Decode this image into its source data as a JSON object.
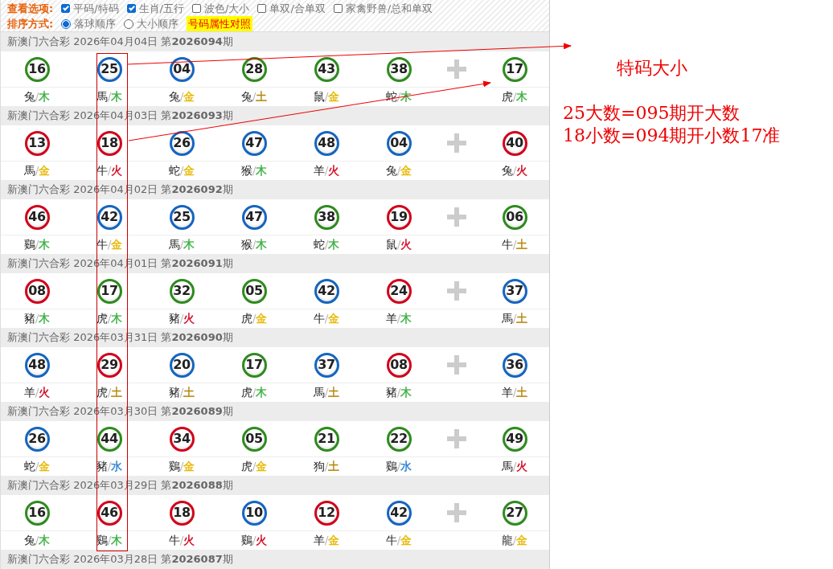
{
  "options": {
    "label": "查看选项:",
    "checkboxes": [
      {
        "label": "平码/特码",
        "checked": true
      },
      {
        "label": "生肖/五行",
        "checked": true
      },
      {
        "label": "波色/大小",
        "checked": false
      },
      {
        "label": "单双/合单双",
        "checked": false
      },
      {
        "label": "家禽野兽/总和单双",
        "checked": false
      }
    ]
  },
  "sort": {
    "label": "排序方式:",
    "radios": [
      {
        "label": "落球顺序",
        "selected": true
      },
      {
        "label": "大小顺序",
        "selected": false
      }
    ],
    "link": "号码属性对照"
  },
  "draws": [
    {
      "title": "新澳门六合彩 2026年04月04日 第**2026094**期",
      "balls": [
        {
          "number": "16",
          "color": "#2e8b1e",
          "label": "兔/木",
          "element": {
            "color": "#3cb043"
          }
        },
        {
          "number": "25",
          "color": "#1565c0",
          "label": "馬/木",
          "element": {
            "color": "#3cb043"
          }
        },
        {
          "number": "04",
          "color": "#1565c0",
          "label": "兔/金",
          "element": {
            "color": "#e6b800"
          }
        },
        {
          "number": "28",
          "color": "#2e8b1e",
          "label": "兔/土",
          "element": {
            "color": "#b8860b"
          }
        },
        {
          "number": "43",
          "color": "#2e8b1e",
          "label": "鼠/金",
          "element": {
            "color": "#e6b800"
          }
        },
        {
          "number": "38",
          "color": "#2e8b1e",
          "label": "蛇/木",
          "element": {
            "color": "#3cb043"
          }
        },
        {
          "number": "17",
          "color": "#2e8b1e",
          "label": "虎/木",
          "element": {
            "color": "#3cb043"
          }
        }
      ]
    },
    {
      "title": "新澳门六合彩 2026年04月03日 第**2026093**期",
      "balls": [
        {
          "number": "13",
          "color": "#d0021b",
          "label": "馬/金",
          "element": {
            "color": "#e6b800"
          }
        },
        {
          "number": "18",
          "color": "#d0021b",
          "label": "牛/火",
          "element": {
            "color": "#d0021b"
          }
        },
        {
          "number": "26",
          "color": "#1565c0",
          "label": "蛇/金",
          "element": {
            "color": "#e6b800"
          }
        },
        {
          "number": "47",
          "color": "#1565c0",
          "label": "猴/木",
          "element": {
            "color": "#3cb043"
          }
        },
        {
          "number": "48",
          "color": "#1565c0",
          "label": "羊/火",
          "element": {
            "color": "#d0021b"
          }
        },
        {
          "number": "04",
          "color": "#1565c0",
          "label": "兔/金",
          "element": {
            "color": "#e6b800"
          }
        },
        {
          "number": "40",
          "color": "#d0021b",
          "label": "兔/火",
          "element": {
            "color": "#d0021b"
          }
        }
      ]
    },
    {
      "title": "新澳门六合彩 2026年04月02日 第**2026092**期",
      "balls": [
        {
          "number": "46",
          "color": "#d0021b",
          "label": "鷄/木",
          "element": {
            "color": "#3cb043"
          }
        },
        {
          "number": "42",
          "color": "#1565c0",
          "label": "牛/金",
          "element": {
            "color": "#e6b800"
          }
        },
        {
          "number": "25",
          "color": "#1565c0",
          "label": "馬/木",
          "element": {
            "color": "#3cb043"
          }
        },
        {
          "number": "47",
          "color": "#1565c0",
          "label": "猴/木",
          "element": {
            "color": "#3cb043"
          }
        },
        {
          "number": "38",
          "color": "#2e8b1e",
          "label": "蛇/木",
          "element": {
            "color": "#3cb043"
          }
        },
        {
          "number": "19",
          "color": "#d0021b",
          "label": "鼠/火",
          "element": {
            "color": "#d0021b"
          }
        },
        {
          "number": "06",
          "color": "#2e8b1e",
          "label": "牛/土",
          "element": {
            "color": "#b8860b"
          }
        }
      ]
    },
    {
      "title": "新澳门六合彩 2026年04月01日 第**2026091**期",
      "balls": [
        {
          "number": "08",
          "color": "#d0021b",
          "label": "豬/木",
          "element": {
            "color": "#3cb043"
          }
        },
        {
          "number": "17",
          "color": "#2e8b1e",
          "label": "虎/木",
          "element": {
            "color": "#3cb043"
          }
        },
        {
          "number": "32",
          "color": "#2e8b1e",
          "label": "豬/火",
          "element": {
            "color": "#d0021b"
          }
        },
        {
          "number": "05",
          "color": "#2e8b1e",
          "label": "虎/金",
          "element": {
            "color": "#e6b800"
          }
        },
        {
          "number": "42",
          "color": "#1565c0",
          "label": "牛/金",
          "element": {
            "color": "#e6b800"
          }
        },
        {
          "number": "24",
          "color": "#d0021b",
          "label": "羊/木",
          "element": {
            "color": "#3cb043"
          }
        },
        {
          "number": "37",
          "color": "#1565c0",
          "label": "馬/土",
          "element": {
            "color": "#b8860b"
          }
        }
      ]
    },
    {
      "title": "新澳门六合彩 2026年03月31日 第**2026090**期",
      "balls": [
        {
          "number": "48",
          "color": "#1565c0",
          "label": "羊/火",
          "element": {
            "color": "#d0021b"
          }
        },
        {
          "number": "29",
          "color": "#d0021b",
          "label": "虎/土",
          "element": {
            "color": "#b8860b"
          }
        },
        {
          "number": "20",
          "color": "#1565c0",
          "label": "豬/土",
          "element": {
            "color": "#b8860b"
          }
        },
        {
          "number": "17",
          "color": "#2e8b1e",
          "label": "虎/木",
          "element": {
            "color": "#3cb043"
          }
        },
        {
          "number": "37",
          "color": "#1565c0",
          "label": "馬/土",
          "element": {
            "color": "#b8860b"
          }
        },
        {
          "number": "08",
          "color": "#d0021b",
          "label": "豬/木",
          "element": {
            "color": "#3cb043"
          }
        },
        {
          "number": "36",
          "color": "#1565c0",
          "label": "羊/土",
          "element": {
            "color": "#b8860b"
          }
        }
      ]
    },
    {
      "title": "新澳门六合彩 2026年03月30日 第**2026089**期",
      "balls": [
        {
          "number": "26",
          "color": "#1565c0",
          "label": "蛇/金",
          "element": {
            "color": "#e6b800"
          }
        },
        {
          "number": "44",
          "color": "#2e8b1e",
          "label": "豬/水",
          "element": {
            "color": "#2f80d1"
          }
        },
        {
          "number": "34",
          "color": "#d0021b",
          "label": "鷄/金",
          "element": {
            "color": "#e6b800"
          }
        },
        {
          "number": "05",
          "color": "#2e8b1e",
          "label": "虎/金",
          "element": {
            "color": "#e6b800"
          }
        },
        {
          "number": "21",
          "color": "#2e8b1e",
          "label": "狗/土",
          "element": {
            "color": "#b8860b"
          }
        },
        {
          "number": "22",
          "color": "#2e8b1e",
          "label": "鷄/水",
          "element": {
            "color": "#2f80d1"
          }
        },
        {
          "number": "49",
          "color": "#2e8b1e",
          "label": "馬/火",
          "element": {
            "color": "#d0021b"
          }
        }
      ]
    },
    {
      "title": "新澳门六合彩 2026年03月29日 第**2026088**期",
      "balls": [
        {
          "number": "16",
          "color": "#2e8b1e",
          "label": "兔/木",
          "element": {
            "color": "#3cb043"
          }
        },
        {
          "number": "46",
          "color": "#d0021b",
          "label": "鷄/木",
          "element": {
            "color": "#3cb043"
          }
        },
        {
          "number": "18",
          "color": "#d0021b",
          "label": "牛/火",
          "element": {
            "color": "#d0021b"
          }
        },
        {
          "number": "10",
          "color": "#1565c0",
          "label": "鷄/火",
          "element": {
            "color": "#d0021b"
          }
        },
        {
          "number": "12",
          "color": "#d0021b",
          "label": "羊/金",
          "element": {
            "color": "#e6b800"
          }
        },
        {
          "number": "42",
          "color": "#1565c0",
          "label": "牛/金",
          "element": {
            "color": "#e6b800"
          }
        },
        {
          "number": "27",
          "color": "#2e8b1e",
          "label": "龍/金",
          "element": {
            "color": "#e6b800"
          }
        }
      ]
    },
    {
      "title": "新澳门六合彩 2026年03月28日 第**2026087**期"
    }
  ],
  "annotation": {
    "title": "特码大小",
    "lines": [
      "25大数=095期开大数",
      "18小数=094期开小数17准"
    ]
  }
}
